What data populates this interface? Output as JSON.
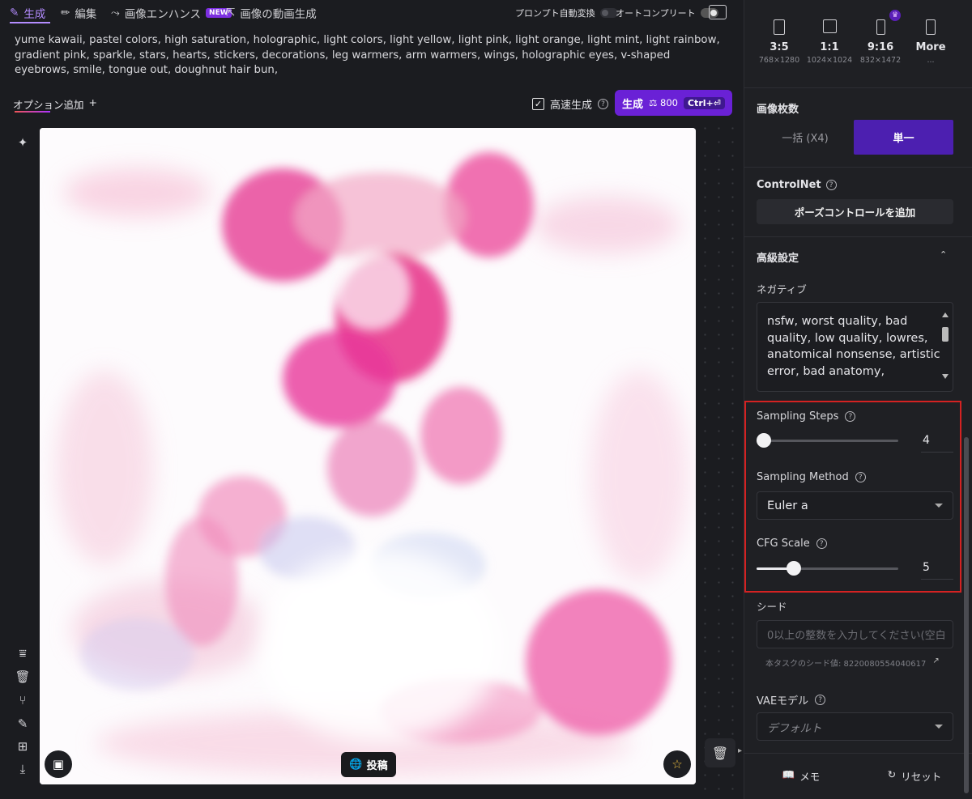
{
  "tabs": [
    {
      "label": "生成",
      "icon": "brush-icon",
      "active": true
    },
    {
      "label": "編集",
      "icon": "pencil-icon"
    },
    {
      "label": "画像エンハンス",
      "icon": "enhance-icon",
      "badge": "NEW"
    },
    {
      "label": "画像の動画生成",
      "icon": "video-export-icon"
    }
  ],
  "toggles": {
    "prompt_auto_convert": {
      "label": "プロンプト自動変換",
      "on": false
    },
    "autocomplete": {
      "label": "オートコンプリート",
      "on": true
    }
  },
  "prompt": "yume kawaii, pastel colors, high saturation, holographic, light colors, light yellow, light pink, light orange, light mint, light rainbow, gradient pink, sparkle, stars, hearts, stickers, decorations, leg warmers, arm warmers, wings, holographic eyes, v-shaped eyebrows, smile, tongue out, doughnut hair bun,",
  "options": {
    "add_label": "オプション追加",
    "plus": "+"
  },
  "fast_gen": {
    "label": "高速生成",
    "checked": true,
    "help": "?"
  },
  "generate": {
    "label": "生成",
    "cost": "800",
    "shortcut": "Ctrl+⏎"
  },
  "canvas": {
    "post_label": "投稿"
  },
  "ratios": [
    {
      "label": "3:5",
      "dim": "768×1280"
    },
    {
      "label": "1:1",
      "dim": "1024×1024"
    },
    {
      "label": "9:16",
      "dim": "832×1472",
      "premium": true
    },
    {
      "label": "More",
      "dim": "..."
    }
  ],
  "image_count": {
    "title": "画像枚数",
    "options": [
      "一括 (X4)",
      "単一"
    ],
    "selected": "単一"
  },
  "controlnet": {
    "title": "ControlNet",
    "button": "ポーズコントロールを追加"
  },
  "advanced": {
    "title": "高級設定"
  },
  "negative": {
    "label": "ネガティブ",
    "value": "nsfw, worst quality, bad quality, low quality, lowres, anatomical nonsense, artistic error, bad anatomy,"
  },
  "sampling_steps": {
    "label": "Sampling Steps",
    "value": "4",
    "fraction": 0.0
  },
  "sampling_method": {
    "label": "Sampling Method",
    "value": "Euler a"
  },
  "cfg_scale": {
    "label": "CFG Scale",
    "value": "5",
    "fraction": 0.26
  },
  "seed": {
    "label": "シード",
    "placeholder": "0以上の整数を入力してください(空白",
    "task_seed": "本タスクのシード値: 8220080554040617"
  },
  "vae": {
    "label": "VAEモデル",
    "placeholder": "デフォルト"
  },
  "footer": {
    "memo": "メモ",
    "reset": "リセット"
  },
  "colors": {
    "accent": "#6a21d6",
    "selected_seg": "#4c1fb0",
    "highlight": "#d42222"
  }
}
